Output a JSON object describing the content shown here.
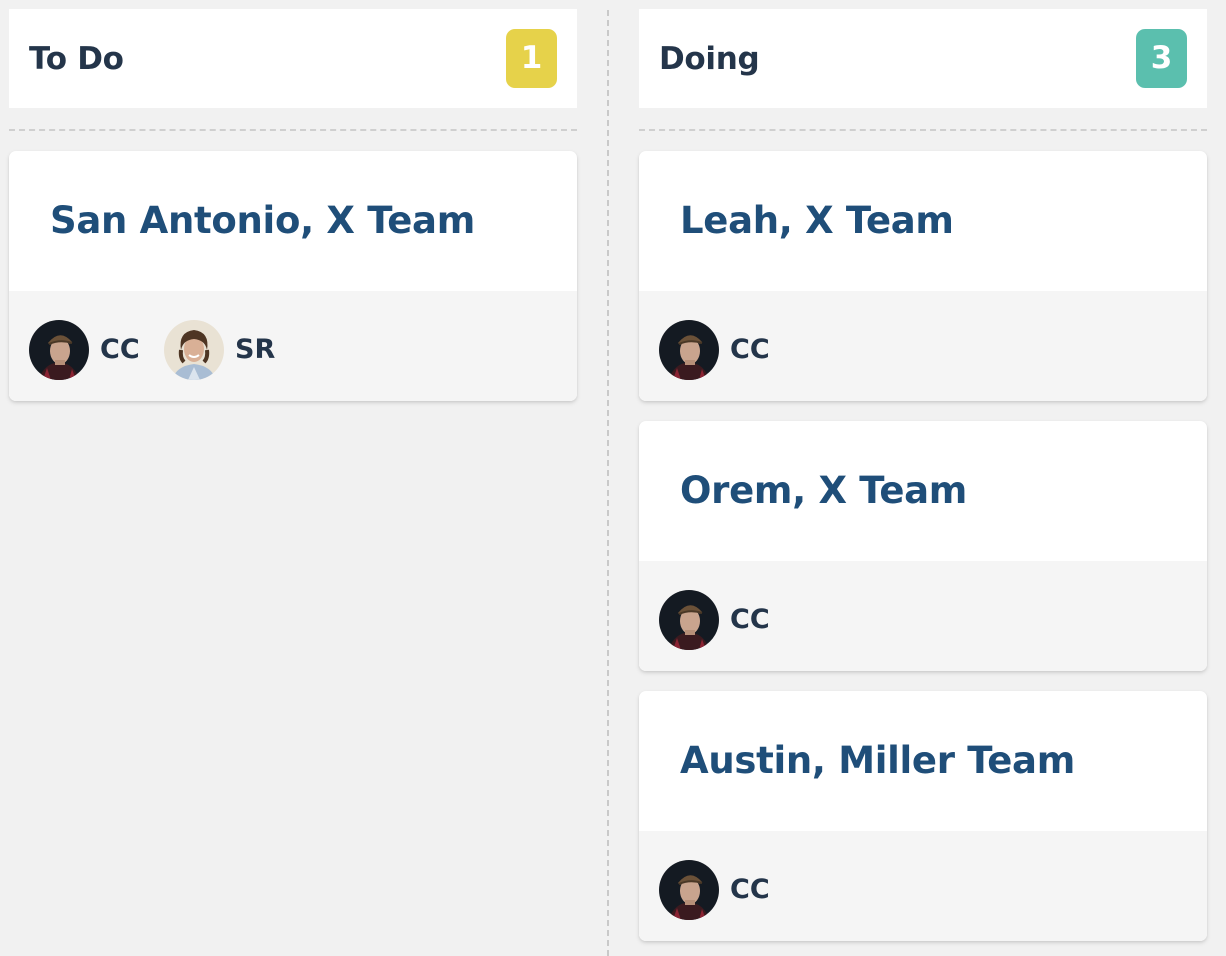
{
  "colors": {
    "todo_badge": "#e6d24a",
    "doing_badge": "#5bbfae",
    "card_title": "#1f4e79",
    "header_text": "#24354a",
    "board_bg": "#f1f1f1"
  },
  "columns": [
    {
      "title": "To Do",
      "count": "1",
      "cards": [
        {
          "title": "San Antonio, X Team",
          "assignees": [
            {
              "initials": "CC",
              "avatar_icon": "avatar-cc"
            },
            {
              "initials": "SR",
              "avatar_icon": "avatar-sr"
            }
          ]
        }
      ]
    },
    {
      "title": "Doing",
      "count": "3",
      "cards": [
        {
          "title": "Leah, X Team",
          "assignees": [
            {
              "initials": "CC",
              "avatar_icon": "avatar-cc"
            }
          ]
        },
        {
          "title": "Orem, X Team",
          "assignees": [
            {
              "initials": "CC",
              "avatar_icon": "avatar-cc"
            }
          ]
        },
        {
          "title": "Austin, Miller Team",
          "assignees": [
            {
              "initials": "CC",
              "avatar_icon": "avatar-cc"
            }
          ]
        }
      ]
    }
  ]
}
